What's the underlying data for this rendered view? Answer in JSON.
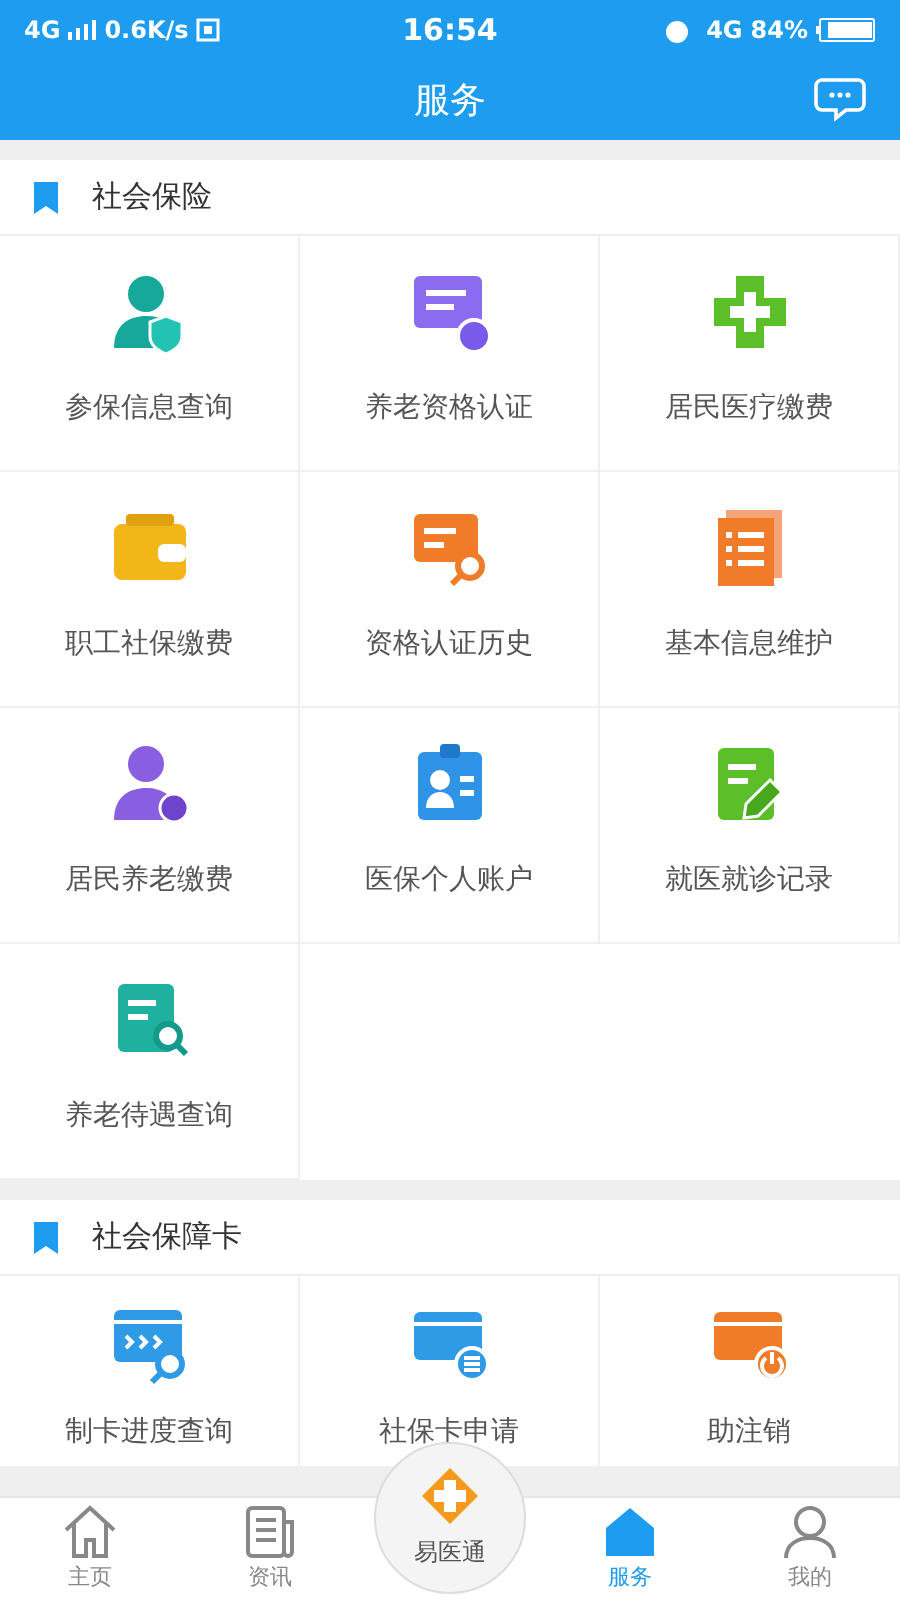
{
  "status_bar": {
    "network": "4G",
    "speed": "0.6K/s",
    "time": "16:54",
    "network_right": "4G",
    "battery": "84%"
  },
  "header": {
    "title": "服务"
  },
  "sections": [
    {
      "title": "社会保险",
      "items": [
        {
          "label": "参保信息查询"
        },
        {
          "label": "养老资格认证"
        },
        {
          "label": "居民医疗缴费"
        },
        {
          "label": "职工社保缴费"
        },
        {
          "label": "资格认证历史"
        },
        {
          "label": "基本信息维护"
        },
        {
          "label": "居民养老缴费"
        },
        {
          "label": "医保个人账户"
        },
        {
          "label": "就医就诊记录"
        },
        {
          "label": "养老待遇查询"
        }
      ]
    },
    {
      "title": "社会保障卡",
      "items": [
        {
          "label": "制卡进度查询"
        },
        {
          "label": "社保卡申请"
        },
        {
          "label": "助注销"
        }
      ]
    }
  ],
  "bottom_nav": [
    {
      "label": "主页",
      "selected": false
    },
    {
      "label": "资讯",
      "selected": false
    },
    {
      "label": "易医通",
      "selected": false,
      "kind": "center"
    },
    {
      "label": "服务",
      "selected": true
    },
    {
      "label": "我的",
      "selected": false
    }
  ]
}
